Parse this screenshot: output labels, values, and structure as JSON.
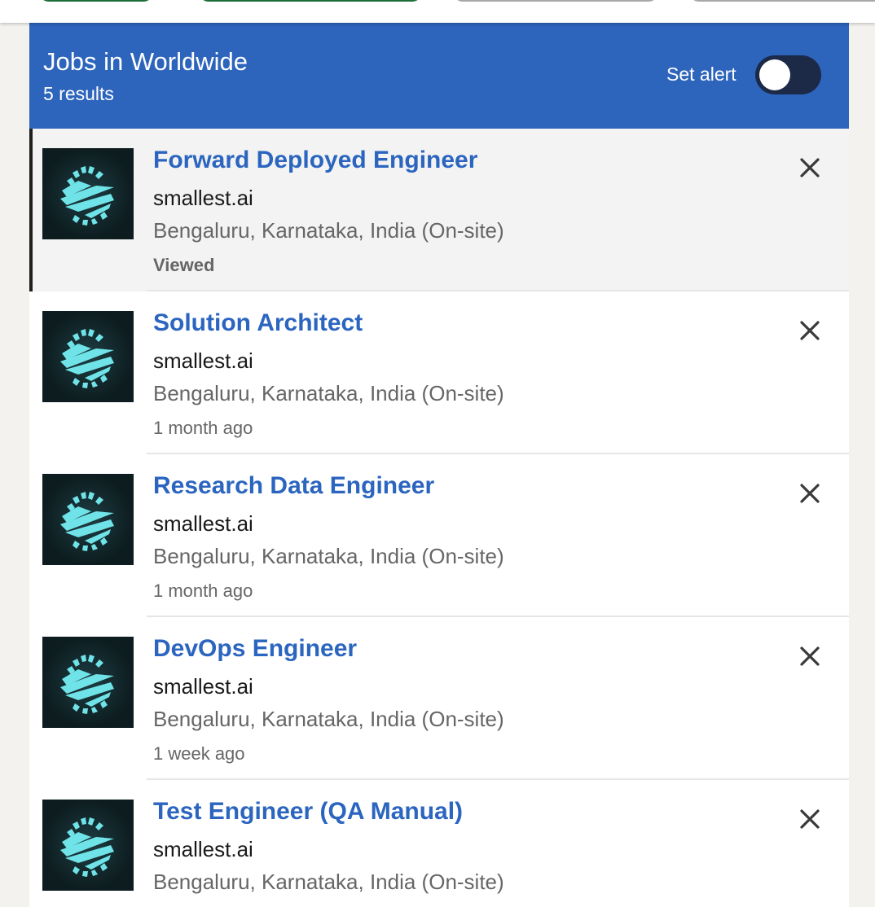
{
  "header": {
    "title": "Jobs in Worldwide",
    "results": "5 results",
    "alert_label": "Set alert",
    "alert_on": false
  },
  "colors": {
    "header_bg": "#2d64bc",
    "title_link": "#2b65bf",
    "toggle_track": "#1c2a48",
    "logo_bg": "#0d1c1f",
    "logo_mark": "#6fe3e8"
  },
  "jobs": [
    {
      "title": "Forward Deployed Engineer",
      "company": "smallest.ai",
      "location": "Bengaluru, Karnataka, India (On-site)",
      "meta": "Viewed",
      "logo_icon": "smallest-ai-logo",
      "dismiss_icon": "close-icon"
    },
    {
      "title": "Solution Architect",
      "company": "smallest.ai",
      "location": "Bengaluru, Karnataka, India (On-site)",
      "meta": "1 month ago",
      "logo_icon": "smallest-ai-logo",
      "dismiss_icon": "close-icon"
    },
    {
      "title": "Research Data Engineer",
      "company": "smallest.ai",
      "location": "Bengaluru, Karnataka, India (On-site)",
      "meta": "1 month ago",
      "logo_icon": "smallest-ai-logo",
      "dismiss_icon": "close-icon"
    },
    {
      "title": "DevOps Engineer",
      "company": "smallest.ai",
      "location": "Bengaluru, Karnataka, India (On-site)",
      "meta": "1 week ago",
      "logo_icon": "smallest-ai-logo",
      "dismiss_icon": "close-icon"
    },
    {
      "title": "Test Engineer (QA Manual)",
      "company": "smallest.ai",
      "location": "Bengaluru, Karnataka, India (On-site)",
      "meta": "",
      "logo_icon": "smallest-ai-logo",
      "dismiss_icon": "close-icon"
    }
  ]
}
